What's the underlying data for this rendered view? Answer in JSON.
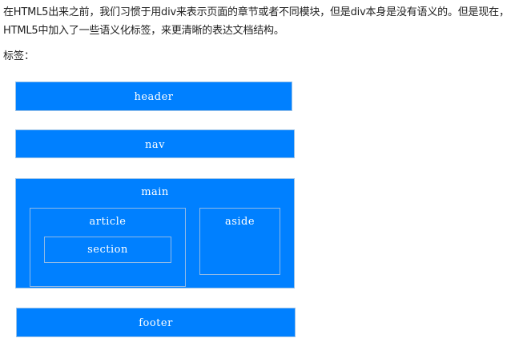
{
  "intro": {
    "line1": "在HTML5出来之前，我们习惯于用div来表示页面的章节或者不同模块，但是div本身是没有语义的。但是现在，",
    "line2": "HTML5中加入了一些语义化标签，来更清晰的表达文档结构。"
  },
  "tags_label": "标签：",
  "diagram": {
    "header": "header",
    "nav": "nav",
    "main": "main",
    "article": "article",
    "section": "section",
    "aside": "aside",
    "footer": "footer"
  },
  "colors": {
    "box_fill": "#0080ff",
    "box_border": "#9cc3e8",
    "label_text": "#ffffff"
  }
}
